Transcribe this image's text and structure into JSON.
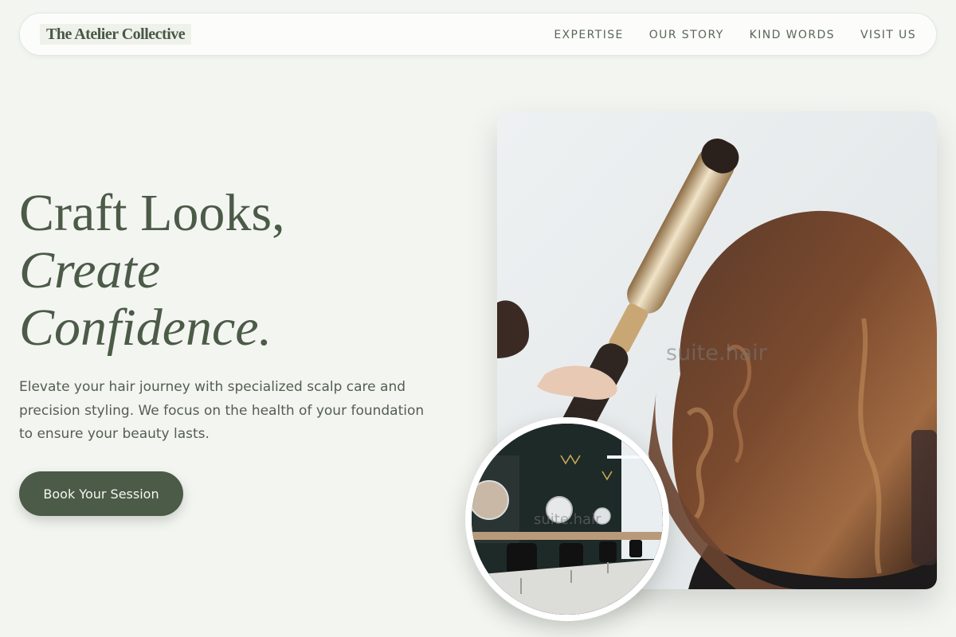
{
  "brand": {
    "name": "The Atelier Collective"
  },
  "nav": {
    "items": [
      {
        "label": "EXPERTISE"
      },
      {
        "label": "OUR STORY"
      },
      {
        "label": "KIND WORDS"
      },
      {
        "label": "VISIT US"
      }
    ]
  },
  "hero": {
    "headline_line1": "Craft Looks,",
    "headline_line2": "Create",
    "headline_line3": "Confidence.",
    "lead": "Elevate your hair journey with specialized scalp care and precision styling. We focus on the health of your foundation to ensure your beauty lasts.",
    "cta_label": "Book Your Session"
  },
  "images": {
    "main_watermark": "suite.hair",
    "inset_watermark": "suite.hair"
  },
  "colors": {
    "accent": "#4c5a48",
    "background": "#f3f5f1",
    "nav_background": "#fcfdfb"
  }
}
